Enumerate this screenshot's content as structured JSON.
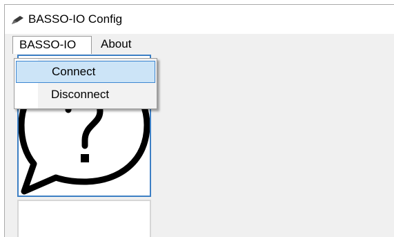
{
  "window": {
    "title": "BASSO-IO Config",
    "icon": "pen-icon"
  },
  "menubar": {
    "items": [
      {
        "label": "BASSO-IO",
        "state": "open"
      },
      {
        "label": "About"
      }
    ]
  },
  "dropdown": {
    "items": [
      {
        "label": "Connect",
        "state": "highlighted"
      },
      {
        "label": "Disconnect"
      }
    ]
  },
  "tiles": [
    {
      "icon": "question-speech-bubble-icon",
      "selected": true
    },
    {
      "icon": "blank",
      "selected": false
    }
  ],
  "colors": {
    "selection_border": "#3c7fc4",
    "highlight_fill": "#cce4f7",
    "window_bg": "#f0f0f0"
  }
}
